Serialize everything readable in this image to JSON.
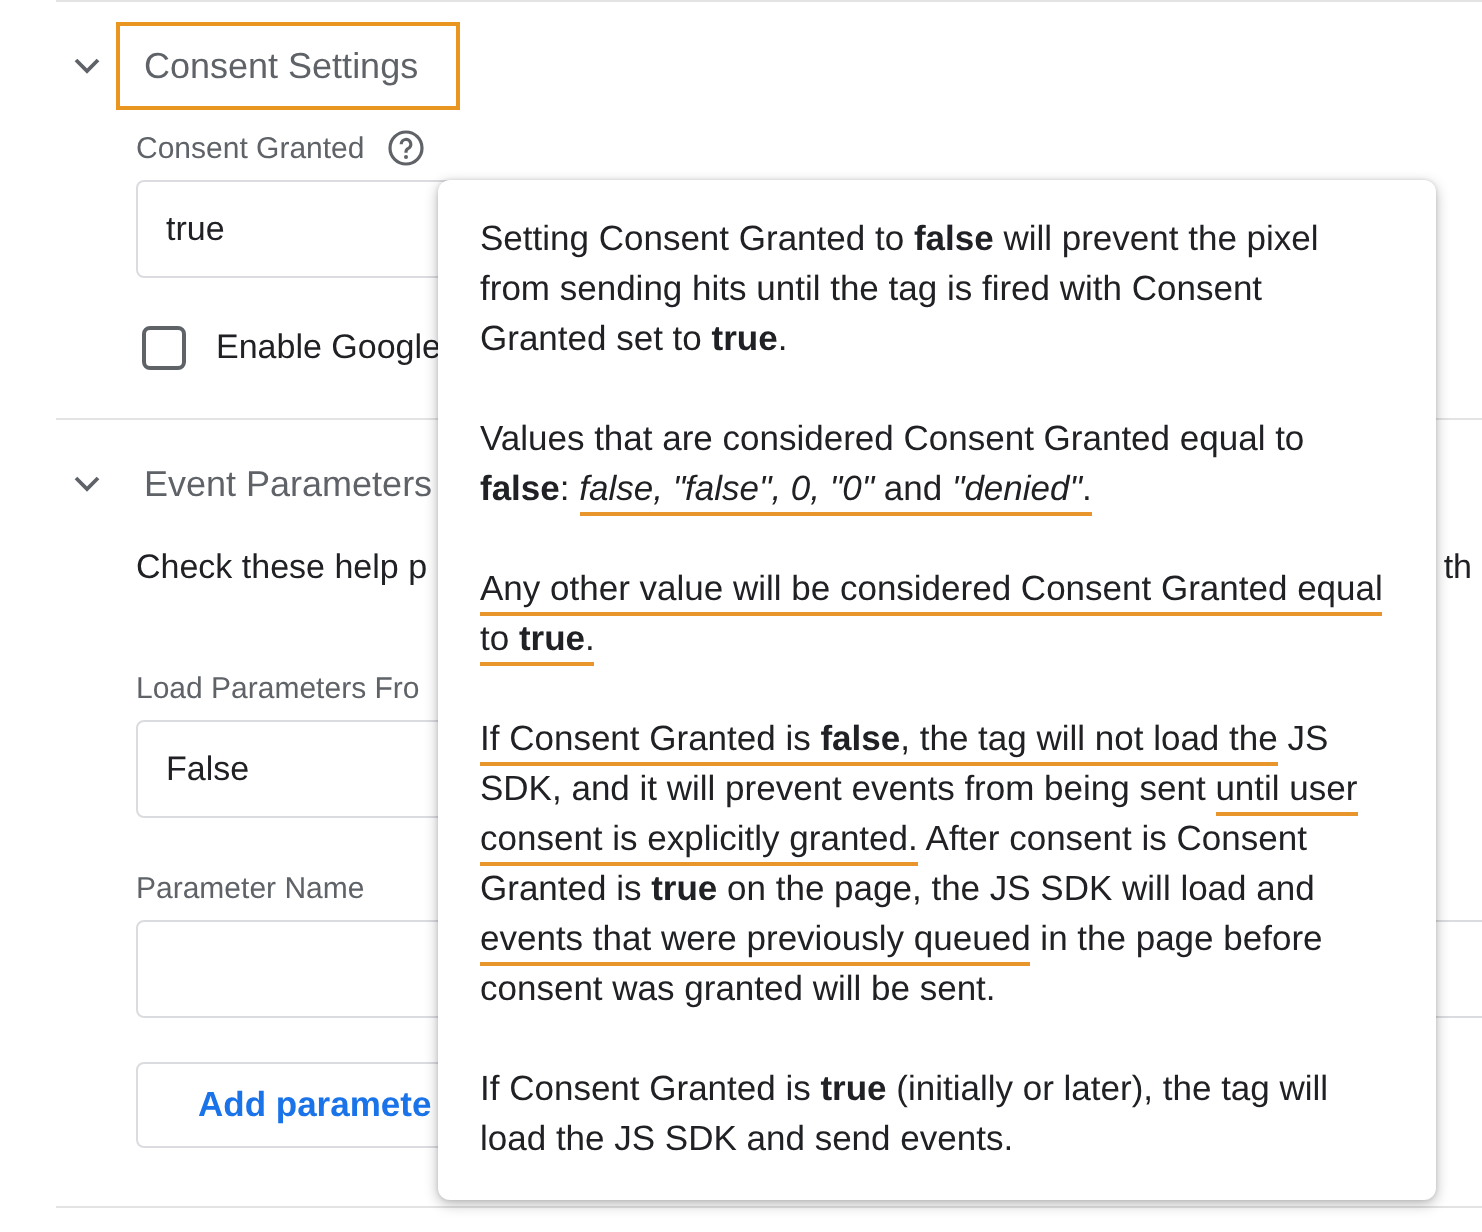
{
  "sections": [
    {
      "title": "Consent Settings",
      "expanded": true,
      "highlighted": true,
      "fields": [
        {
          "kind": "text_input",
          "label": "Consent Granted",
          "help": true,
          "value": "true"
        },
        {
          "kind": "checkbox",
          "label": "Enable Google",
          "checked": false
        }
      ]
    },
    {
      "title": "Event Parameters",
      "expanded": true,
      "highlighted": false,
      "fields": [
        {
          "kind": "help_text",
          "parts": [
            "Check these help p",
            "th"
          ]
        },
        {
          "kind": "dropdown",
          "label": "Load Parameters Fro",
          "value": "False"
        },
        {
          "kind": "param_input",
          "label": "Parameter Name",
          "help": false
        },
        {
          "kind": "button",
          "label": "Add paramete"
        }
      ]
    }
  ],
  "tooltip": {
    "paragraphs": [
      {
        "runs": [
          {
            "text": "Setting Consent Granted to **false** will prevent the pixel from sending hits until the tag is fired with Consent Granted set to **true**.",
            "underlined": false
          }
        ]
      },
      {
        "runs": [
          {
            "text": "Values that are considered Consent Granted equal to **false**: ",
            "underlined": false
          },
          {
            "text": "*false, \"false\", 0, \"0\"* and *\"denied\"*.",
            "underlined": true
          }
        ]
      },
      {
        "runs": [
          {
            "text": "Any other value will be considered Consent Granted equal to **true**.",
            "underlined": true
          }
        ]
      },
      {
        "runs": [
          {
            "text": "If Consent Granted is **false**, the tag will not load the",
            "underlined": true
          },
          {
            "text": " JS SDK, and it will prevent events from being sent ",
            "underlined": false
          },
          {
            "text": "until user consent is explicitly granted.",
            "underlined": true
          },
          {
            "text": " After consent is Consent Granted is **true** on the page, the JS SDK will load and ",
            "underlined": false
          },
          {
            "text": "events that were previously queued",
            "underlined": true
          },
          {
            "text": " in the page before consent was granted will be sent.",
            "underlined": false
          }
        ]
      },
      {
        "runs": [
          {
            "text": "If Consent Granted is **true** (initially or later), the tag will load the JS SDK and send events.",
            "underlined": false
          }
        ]
      }
    ]
  }
}
